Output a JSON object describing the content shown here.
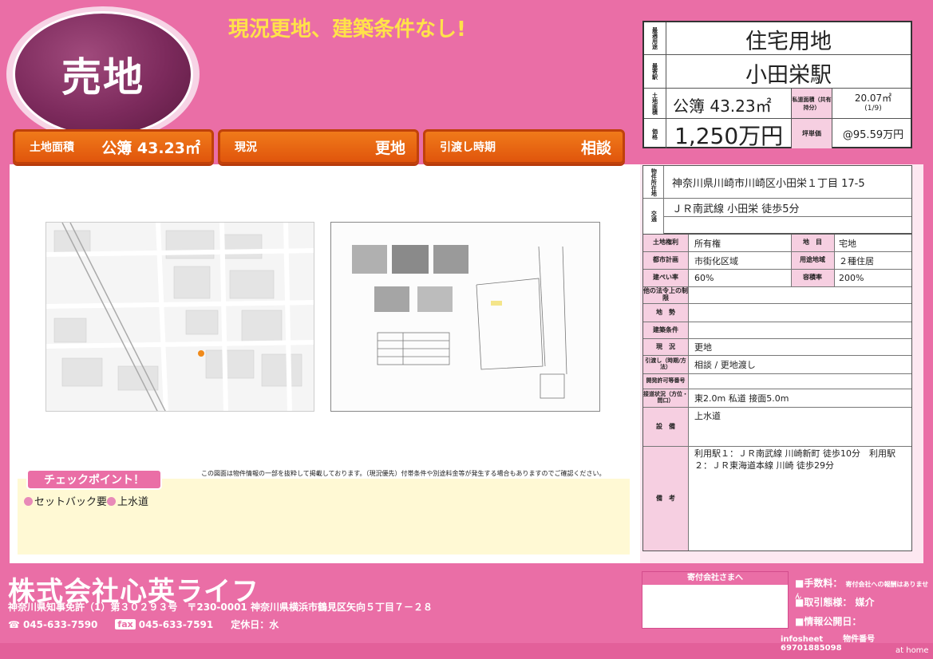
{
  "badge": "売地",
  "headline": "現況更地、建築条件なし!",
  "pills": [
    {
      "label": "土地面積",
      "value": "公簿 43.23㎡"
    },
    {
      "label": "現況",
      "value": "更地"
    },
    {
      "label": "引渡し時期",
      "value": "相談"
    }
  ],
  "summary": {
    "use_label": "最適用途",
    "use_value": "住宅用地",
    "station_label": "最寄駅",
    "station_value": "小田栄駅",
    "area_label": "土地面積",
    "area_value": "公簿 43.23㎡",
    "private_road_label": "私道面積（共有持分）",
    "private_road_value": "20.07㎡",
    "private_road_share": "(1/9)",
    "price_label": "価格",
    "price_value": "1,250万円",
    "tsubo_label": "坪単価",
    "tsubo_value": "@95.59万円"
  },
  "address": {
    "label": "物件所在地",
    "value": "神奈川県川崎市川崎区小田栄１丁目 17-5",
    "traffic_label": "交通",
    "traffic_value": "ＪＲ南武線 小田栄 徒歩5分"
  },
  "details": {
    "land_right_label": "土地権利",
    "land_right_value": "所有権",
    "land_type_label": "地　目",
    "land_type_value": "宅地",
    "city_plan_label": "都市計画",
    "city_plan_value": "市街化区域",
    "zone_label": "用途地域",
    "zone_value": "２種住居",
    "bcr_label": "建ぺい率",
    "bcr_value": "60%",
    "far_label": "容積率",
    "far_value": "200%",
    "restrict_label": "他の法令上の制限",
    "terrain_label": "地　勢",
    "condition_label": "建築条件",
    "status_label": "現　況",
    "status_value": "更地",
    "handover_label": "引渡し（時期/方法）",
    "handover_value": "相談 / 更地渡し",
    "permit_label": "開発許可等番号",
    "road_label": "接道状況（方位・間口）",
    "road_value": "東2.0m 私道 接面5.0m",
    "facility_label": "設　備",
    "facility_value": "上水道",
    "remarks_label": "備　考",
    "remarks_value": "利用駅１：ＪＲ南武線 川崎新町 徒歩10分　利用駅２：ＪＲ東海道本線 川崎 徒歩29分"
  },
  "note": "この図面は物件情報の一部を抜粋して掲載しております。（現況優先）付帯条件や別途料金等が発生する場合もありますのでご確認ください。",
  "checkpoint": {
    "title": "チェックポイント！",
    "items": [
      "セットバック要",
      "上水道"
    ]
  },
  "company": {
    "name": "株式会社心英ライフ",
    "license": "神奈川県知事免許（1）第３０２９３号　〒230-0001 神奈川県横浜市鶴見区矢向５丁目７－２８",
    "tel": "045-633-7590",
    "fax_tag": "fax",
    "fax": "045-633-7591",
    "holiday": "定休日：水"
  },
  "stamp_title": "寄付会社さまへ",
  "fees": {
    "fee_label": "■手数料：",
    "fee_note": "寄付会社への報酬はありません",
    "deal_label": "■取引態様：",
    "deal_value": "媒介",
    "publish_label": "■情報公開日："
  },
  "infosheet": {
    "label": "infosheet",
    "num_label": "物件番号",
    "num_value": "69701885098"
  },
  "brand": "at home",
  "colors": {
    "pink": "#ea6ea6",
    "orange": "#e0550c",
    "yellow": "#ffe24a"
  }
}
